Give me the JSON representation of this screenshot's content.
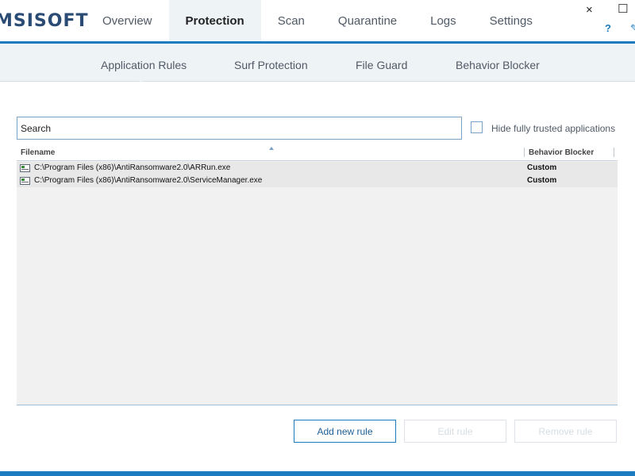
{
  "app": {
    "logo_text": "MSISOFT",
    "help_label": "?",
    "minimize_label": "×",
    "close_label": "☐"
  },
  "main_tabs": [
    {
      "label": "Overview"
    },
    {
      "label": "Protection",
      "active": true
    },
    {
      "label": "Scan"
    },
    {
      "label": "Quarantine"
    },
    {
      "label": "Logs"
    },
    {
      "label": "Settings"
    }
  ],
  "sub_tabs": [
    {
      "label": "Application Rules",
      "active": true
    },
    {
      "label": "Surf Protection"
    },
    {
      "label": "File Guard"
    },
    {
      "label": "Behavior Blocker"
    }
  ],
  "search": {
    "placeholder": "Search",
    "value": ""
  },
  "hide_trusted": {
    "label": "Hide fully trusted applications",
    "checked": false
  },
  "table": {
    "columns": [
      {
        "label": "Filename"
      },
      {
        "label": "Behavior Blocker"
      }
    ],
    "rows": [
      {
        "filename": "C:\\Program Files (x86)\\AntiRansomware2.0\\ARRun.exe",
        "behavior_blocker": "Custom"
      },
      {
        "filename": "C:\\Program Files (x86)\\AntiRansomware2.0\\ServiceManager.exe",
        "behavior_blocker": "Custom"
      }
    ]
  },
  "buttons": {
    "add_label": "Add new rule",
    "edit_label": "Edit rule",
    "remove_label": "Remove rule"
  },
  "colors": {
    "accent": "#1d7bbf",
    "logo": "#2a4b74",
    "subbar_bg": "#eef3f6"
  }
}
